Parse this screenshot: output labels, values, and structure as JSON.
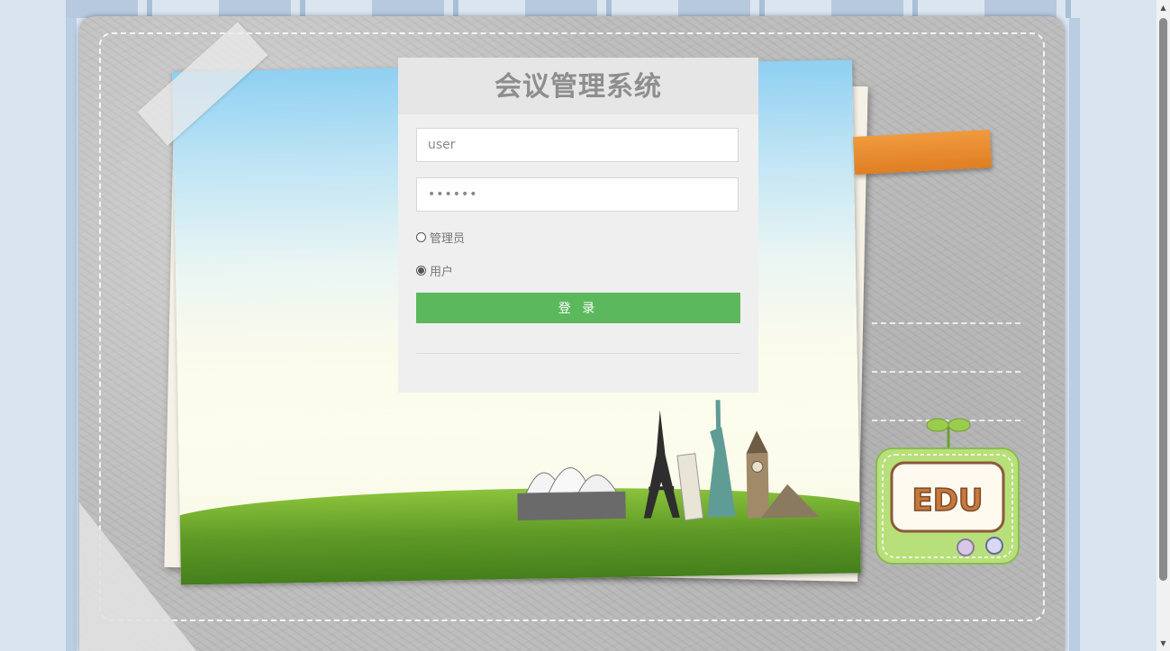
{
  "login": {
    "title": "会议管理系统",
    "username_value": "user",
    "password_value": "••••••",
    "roles": [
      {
        "label": "管理员",
        "checked": false
      },
      {
        "label": "用户",
        "checked": true
      }
    ],
    "submit_label": "登 录"
  },
  "decor": {
    "badge_text": "EDU"
  },
  "colors": {
    "button_green": "#5cb85c",
    "title_gray": "#8e8e8e",
    "tape_orange": "#e8862c"
  }
}
